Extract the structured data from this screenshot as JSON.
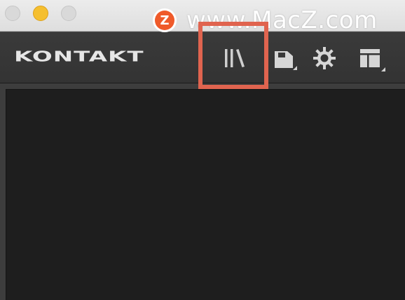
{
  "app": {
    "brand": "KONTAKT"
  },
  "watermark": {
    "logo_letter": "Z",
    "text": "www.MacZ.com"
  },
  "toolbar": {
    "buttons": [
      {
        "name": "library",
        "icon": "library-icon"
      },
      {
        "name": "save",
        "icon": "floppy-disk-icon"
      },
      {
        "name": "options",
        "icon": "gear-icon"
      },
      {
        "name": "view",
        "icon": "layout-icon"
      }
    ]
  },
  "colors": {
    "highlight": "#e0644f",
    "watermark_logo": "#ef5a2a",
    "minimize": "#f5bf2f"
  }
}
